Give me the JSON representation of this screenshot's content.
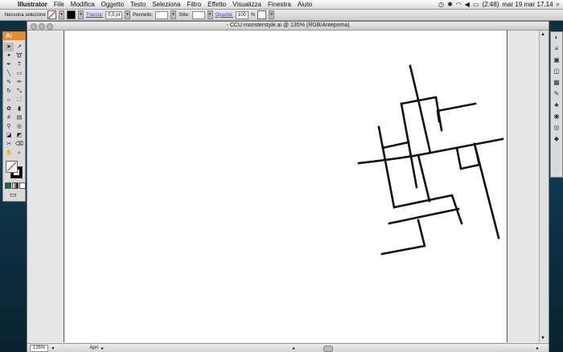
{
  "menubar": {
    "apple": "",
    "app": "Illustrator",
    "items": [
      "File",
      "Modifica",
      "Oggetto",
      "Testo",
      "Seleziona",
      "Filtro",
      "Effetto",
      "Visualizza",
      "Finestra",
      "Aiuto"
    ],
    "battery": "(2:48)",
    "datetime": "mar 19 mar  17.14"
  },
  "control_bar": {
    "selection": "Nessuna selezione",
    "stroke_label": "Traccia:",
    "stroke_weight": "0,5 pt",
    "brush_label": "Pennello:",
    "style_label": "Stile:",
    "opacity_label": "Opacità:",
    "opacity_value": "100",
    "opacity_unit": "%"
  },
  "document": {
    "title": "CCU monsterstyle.ai @ 135% (RGB/Anteprima)",
    "zoom": "135%",
    "status": "Apri"
  },
  "toolbox": {
    "logo": "Ai",
    "tools": [
      "selection-tool",
      "direct-selection-tool",
      "magic-wand-tool",
      "lasso-tool",
      "pen-tool",
      "type-tool",
      "line-tool",
      "rectangle-tool",
      "paintbrush-tool",
      "pencil-tool",
      "rotate-tool",
      "scale-tool",
      "warp-tool",
      "free-transform-tool",
      "symbol-sprayer-tool",
      "column-graph-tool",
      "mesh-tool",
      "gradient-tool",
      "eyedropper-tool",
      "blend-tool",
      "live-paint-tool",
      "live-paint-selection-tool",
      "slice-tool",
      "eraser-tool",
      "hand-tool",
      "zoom-tool"
    ]
  },
  "panels": [
    "color-panel",
    "stroke-panel",
    "gradient-panel",
    "transparency-panel",
    "swatches-panel",
    "brushes-panel",
    "symbols-panel",
    "graphic-styles-panel",
    "appearance-panel",
    "layers-panel"
  ],
  "colors": {
    "accent": "#f08a1e",
    "desktop": "#134760"
  }
}
